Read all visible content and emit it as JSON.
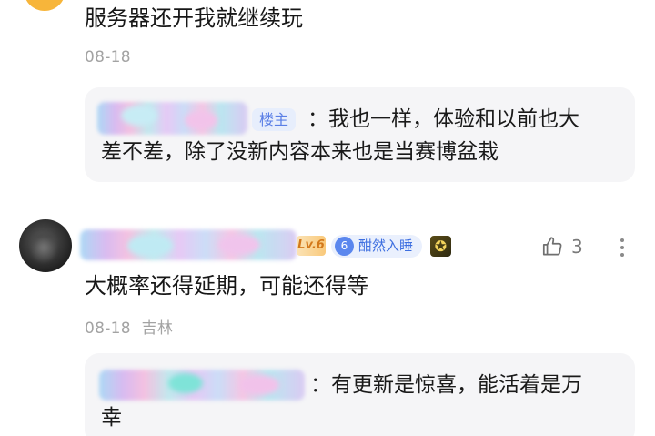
{
  "comment1": {
    "text": "服务器还开我就继续玩",
    "date": "08-18"
  },
  "reply1": {
    "owner_badge": "楼主",
    "line1": "：我也一样，体验和以前也大",
    "line2": "差不差，除了没新内容本来也是当赛博盆栽"
  },
  "comment2": {
    "level": "Lv.6",
    "title_badge_num": "6",
    "title_badge": "酣然入睡",
    "likes": "3",
    "text": "大概率还得延期，可能还得等",
    "date": "08-18",
    "location": "吉林"
  },
  "reply2": {
    "line1": "：有更新是惊喜，能活着是万",
    "line2": "幸"
  },
  "icons": {
    "like": "thumbs-up-icon",
    "more": "more-vertical-icon",
    "medal": "medal-icon"
  },
  "colors": {
    "badge_blue": "#5a7fe6",
    "level_orange": "#d3781a",
    "reply_bg": "#f5f5f7"
  }
}
